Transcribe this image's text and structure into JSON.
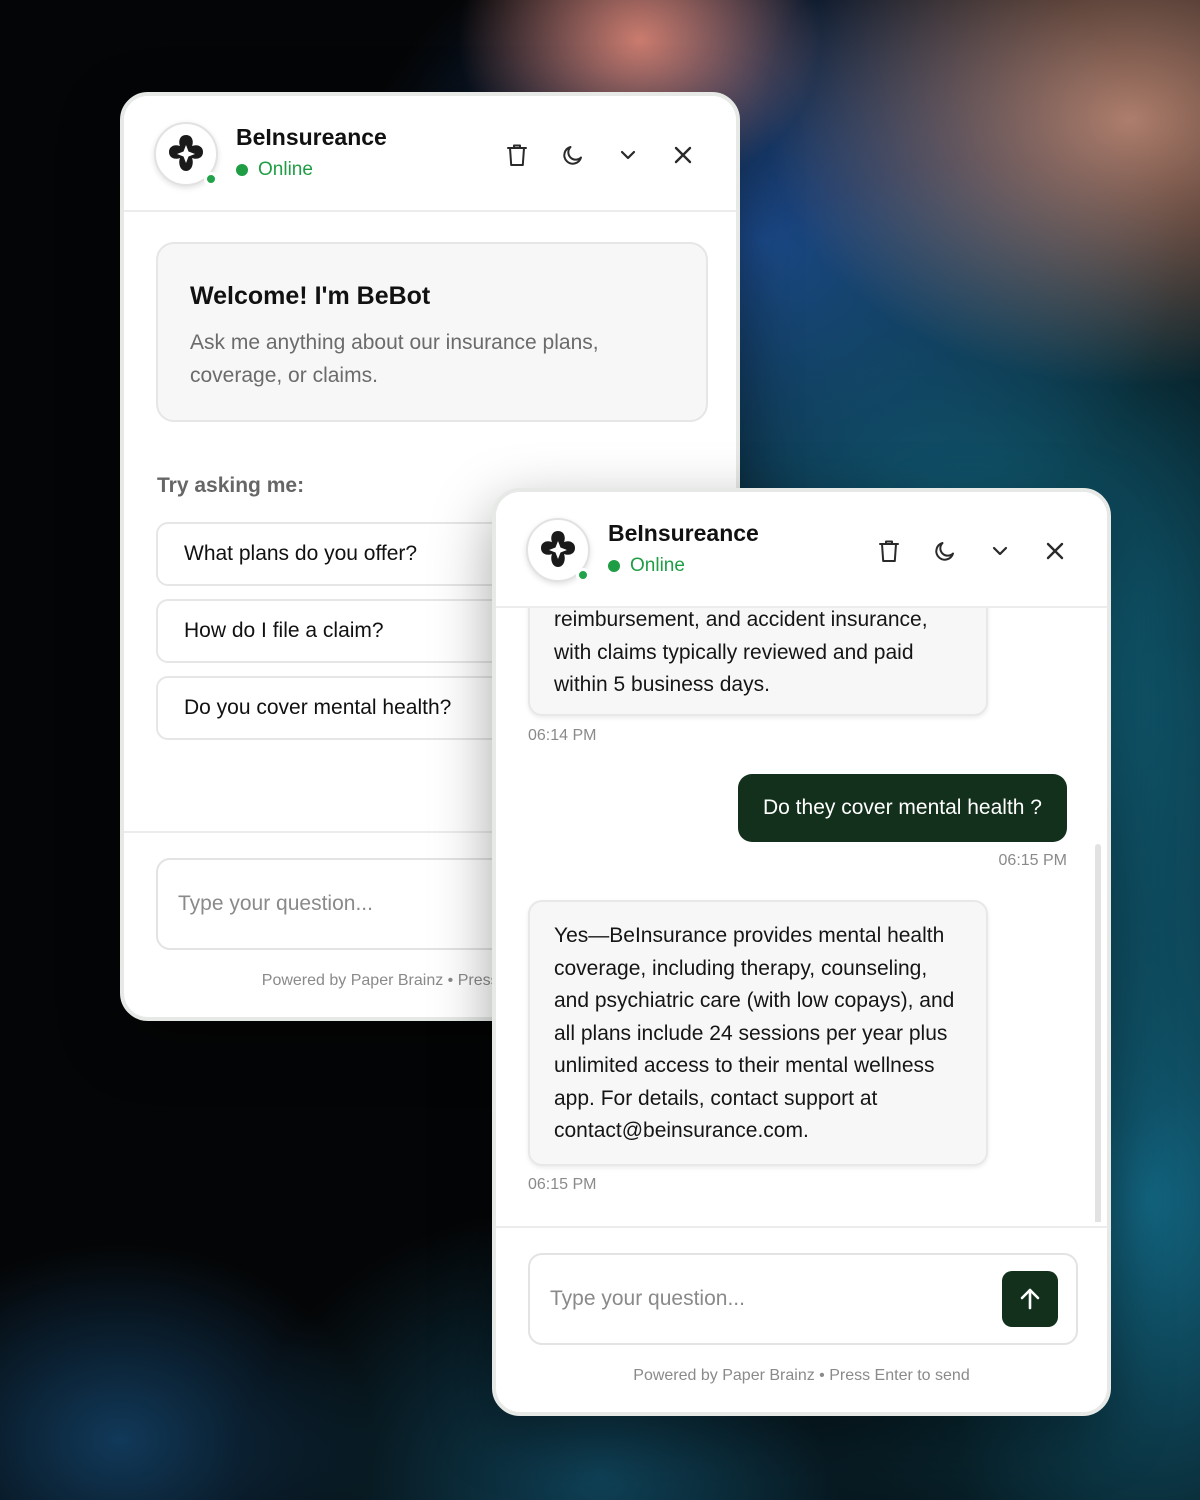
{
  "windows": [
    {
      "header": {
        "brand_name": "BeInsureance",
        "status": "Online"
      },
      "welcome": {
        "title": "Welcome! I'm BeBot",
        "text": "Ask me anything about our insurance plans, coverage, or claims."
      },
      "suggestions_label": "Try asking me:",
      "suggestions": [
        "What plans do you offer?",
        "How do I file a claim?",
        "Do you cover mental health?"
      ],
      "input_placeholder": "Type your question...",
      "footer": "Powered by Paper Brainz • Press Enter to send"
    },
    {
      "header": {
        "brand_name": "BeInsureance",
        "status": "Online"
      },
      "messages": [
        {
          "from": "bot",
          "text": "reimbursement, and accident insurance, with claims typically reviewed and paid within 5 business days.",
          "time": "06:14 PM"
        },
        {
          "from": "user",
          "text": "Do they cover mental health ?",
          "time": "06:15 PM"
        },
        {
          "from": "bot",
          "text": "Yes—BeInsurance provides mental health coverage, including therapy, counseling, and psychiatric care (with low copays), and all plans include 24 sessions per year plus unlimited access to their mental wellness app. For details, contact support at contact@beinsurance.com.",
          "time": "06:15 PM"
        }
      ],
      "input_placeholder": "Type your question...",
      "footer": "Powered by Paper Brainz • Press Enter to send"
    }
  ],
  "icons": {
    "header": [
      "trash-icon",
      "moon-icon",
      "chevron-down-icon",
      "close-icon"
    ],
    "send": "arrow-up-icon",
    "logo": "four-petal-logo-icon"
  },
  "colors": {
    "online_green": "#1f9d45",
    "brand_dark_green": "#12301b",
    "card_bg": "#f7f7f7"
  }
}
